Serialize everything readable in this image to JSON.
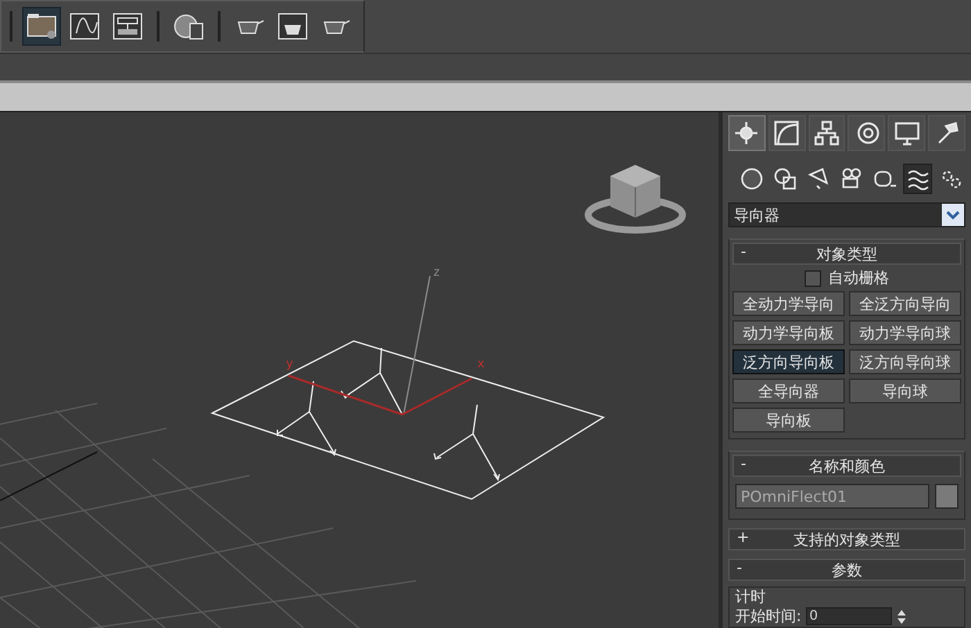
{
  "toolbar": [
    {
      "selected": true
    },
    {
      "selected": false
    },
    {
      "selected": false
    },
    {
      "selected": false
    },
    {
      "selected": false
    },
    {
      "selected": false
    },
    {
      "selected": false
    }
  ],
  "viewport": {
    "axis_labels": [
      {
        "text": "z",
        "color": "#8a8a8a"
      },
      {
        "text": "y",
        "color": "#c03030"
      },
      {
        "text": "x",
        "color": "#c03030"
      }
    ]
  },
  "command_panel": {
    "tabs": [
      {
        "selected": true
      },
      {
        "selected": false
      },
      {
        "selected": false
      },
      {
        "selected": false
      },
      {
        "selected": false
      },
      {
        "selected": false
      }
    ],
    "categories": [
      {
        "selected": false
      },
      {
        "selected": false
      },
      {
        "selected": false
      },
      {
        "selected": false
      },
      {
        "selected": false
      },
      {
        "selected": true
      },
      {
        "selected": false
      }
    ],
    "dropdown": {
      "value": "导向器"
    },
    "object_type": {
      "title": "对象类型",
      "collapse_sign": "-",
      "auto_grid": {
        "label": "自动栅格",
        "checked": false
      },
      "buttons": [
        {
          "label": "全动力学导向",
          "selected": false
        },
        {
          "label": "全泛方向导向",
          "selected": false
        },
        {
          "label": "动力学导向板",
          "selected": false
        },
        {
          "label": "动力学导向球",
          "selected": false
        },
        {
          "label": "泛方向导向板",
          "selected": true
        },
        {
          "label": "泛方向导向球",
          "selected": false
        },
        {
          "label": "全导向器",
          "selected": false
        },
        {
          "label": "导向球",
          "selected": false
        },
        {
          "label": "导向板",
          "selected": false
        }
      ]
    },
    "name_color": {
      "title": "名称和颜色",
      "collapse_sign": "-",
      "name": "POmniFlect01",
      "color": "#7a7a7a"
    },
    "supported": {
      "title": "支持的对象类型",
      "collapse_sign": "+"
    },
    "parameters": {
      "title": "参数",
      "collapse_sign": "-",
      "section": "计时",
      "start_time": {
        "label": "开始时间:",
        "value": "0"
      }
    }
  }
}
